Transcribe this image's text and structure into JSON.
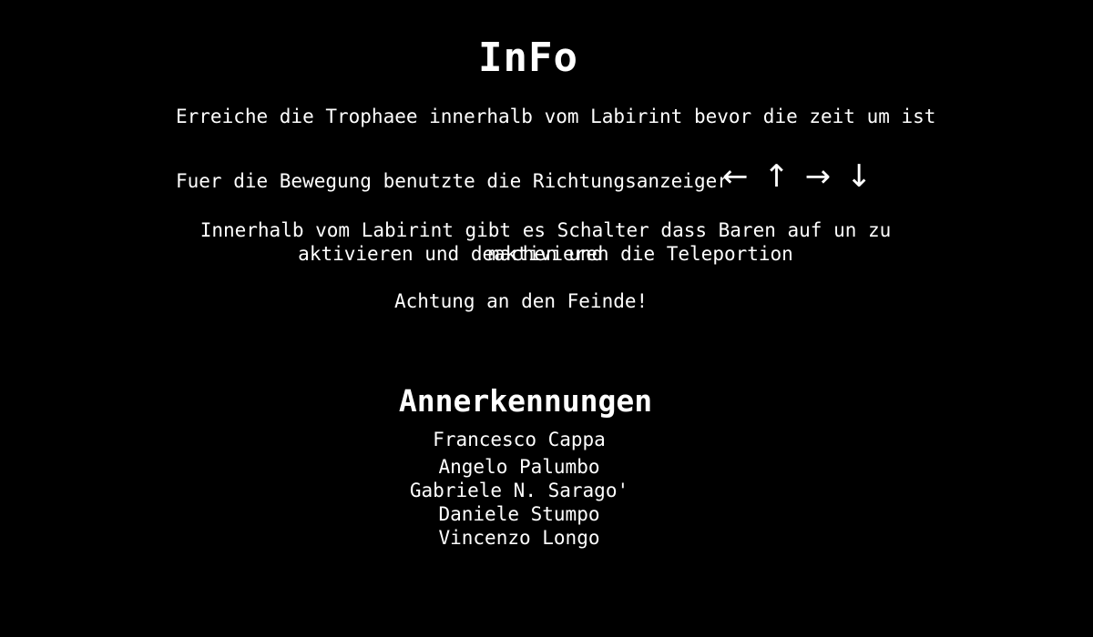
{
  "title": "InFo",
  "info_lines": {
    "goal": "Erreiche die Trophaee innerhalb vom Labirint bevor die zeit um ist",
    "movement": "Fuer die Bewegung benutzte die Richtungsanzeiger",
    "switches_line1": "Innerhalb vom Labirint gibt es Schalter dass Baren auf un zu machen und",
    "switches_line2": "aktivieren und deaktivieren die Teleportion",
    "warning": "Achtung an den Feinde!"
  },
  "arrows": {
    "left": "←",
    "up": "↑",
    "right": "→",
    "down": "↓"
  },
  "credits": {
    "title": "Annerkennungen",
    "names": [
      "Francesco Cappa",
      "Angelo Palumbo",
      "Gabriele N. Sarago'",
      "Daniele Stumpo",
      "Vincenzo Longo"
    ]
  },
  "colors": {
    "background": "#000000",
    "text": "#ffffff"
  }
}
